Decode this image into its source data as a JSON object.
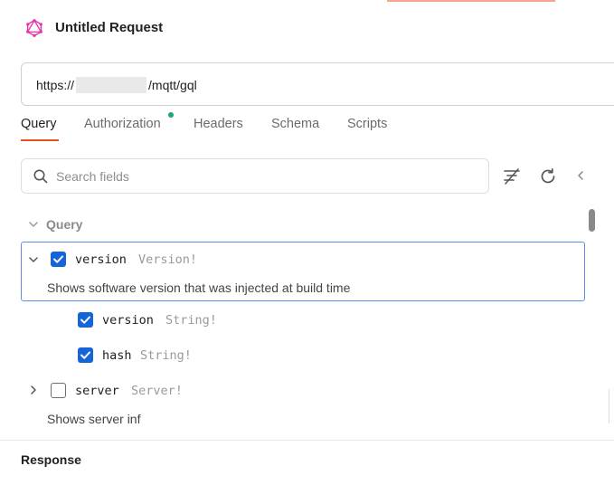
{
  "header": {
    "title": "Untitled Request",
    "logo_icon": "graphql-icon",
    "logo_color": "#e535ab"
  },
  "url_bar": {
    "prefix": "https://",
    "suffix": "/mqtt/gql"
  },
  "tabs": [
    {
      "label": "Query",
      "active": true
    },
    {
      "label": "Authorization",
      "indicator": true
    },
    {
      "label": "Headers"
    },
    {
      "label": "Schema"
    },
    {
      "label": "Scripts"
    }
  ],
  "colors": {
    "accent": "#e0551f",
    "indicator": "#1ba672",
    "checkbox": "#1565d8",
    "selection_border": "#5b8ee6"
  },
  "search": {
    "placeholder": "Search fields",
    "icons": [
      "search-icon",
      "filter-icon",
      "refresh-icon",
      "chevron-left-icon"
    ]
  },
  "tree": {
    "section": "Query",
    "fields": [
      {
        "name": "version",
        "type": "Version!",
        "checked": true,
        "expanded": true,
        "description": "Shows software version that was injected at build time"
      },
      {
        "name": "version",
        "type": "String!",
        "checked": true
      },
      {
        "name": "hash",
        "type": "String!",
        "checked": true
      },
      {
        "name": "server",
        "type": "Server!",
        "checked": false,
        "expanded": false,
        "description": "Shows server inf"
      }
    ]
  },
  "response": {
    "label": "Response"
  }
}
